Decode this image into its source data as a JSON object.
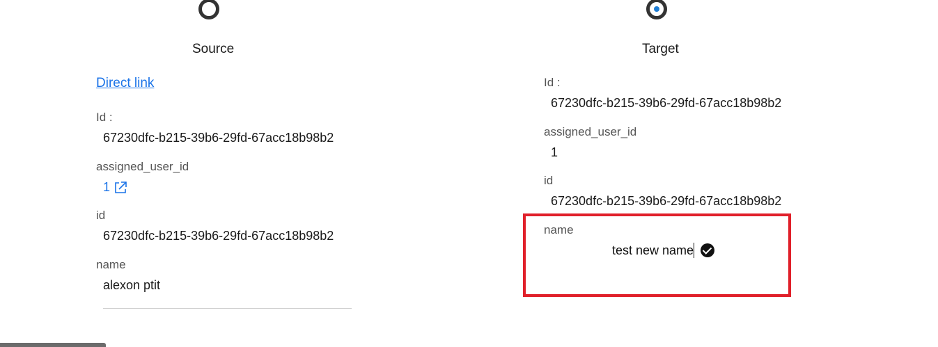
{
  "source": {
    "title": "Source",
    "direct_link": "Direct link",
    "fields": [
      {
        "label": "Id :",
        "value": "67230dfc-b215-39b6-29fd-67acc18b98b2"
      },
      {
        "label": "assigned_user_id",
        "value": "1"
      },
      {
        "label": "id",
        "value": "67230dfc-b215-39b6-29fd-67acc18b98b2"
      },
      {
        "label": "name",
        "value": "alexon ptit"
      }
    ]
  },
  "target": {
    "title": "Target",
    "fields": [
      {
        "label": "Id :",
        "value": "67230dfc-b215-39b6-29fd-67acc18b98b2"
      },
      {
        "label": "assigned_user_id",
        "value": "1"
      },
      {
        "label": "id",
        "value": "67230dfc-b215-39b6-29fd-67acc18b98b2"
      },
      {
        "label": "name",
        "value": "test new name"
      }
    ]
  },
  "colors": {
    "link": "#1a73e8",
    "highlight": "#e0202a",
    "radio_selected_dot": "#1e7dd4"
  }
}
